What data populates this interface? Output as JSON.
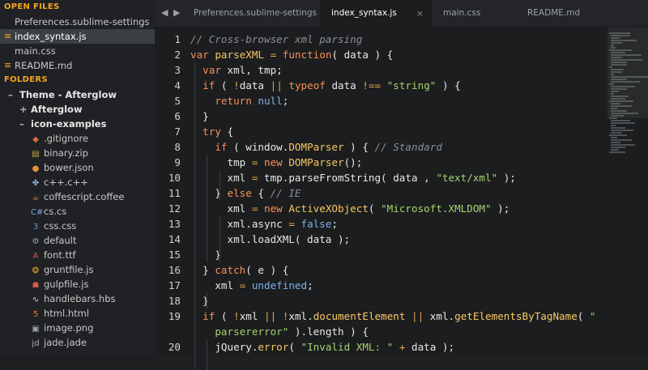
{
  "sidebar": {
    "open_files_header": "OPEN FILES",
    "open_files": [
      {
        "label": "Preferences.sublime-settings",
        "active": false,
        "modified": false
      },
      {
        "label": "index_syntax.js",
        "active": true,
        "modified": true
      },
      {
        "label": "main.css",
        "active": false,
        "modified": false
      },
      {
        "label": "README.md",
        "active": false,
        "modified": true
      }
    ],
    "folders_header": "FOLDERS",
    "tree": [
      {
        "label": "Theme - Afterglow",
        "depth": 0,
        "twist": "–",
        "bold": true
      },
      {
        "label": "Afterglow",
        "depth": 1,
        "twist": "+",
        "bold": true
      },
      {
        "label": "icon-examples",
        "depth": 1,
        "twist": "–",
        "bold": true
      },
      {
        "label": ".gitignore",
        "depth": 2,
        "icon": "◆",
        "icon_color": "#e0683a",
        "icon_name": "git-icon"
      },
      {
        "label": "binary.zip",
        "depth": 2,
        "icon": "▤",
        "icon_color": "#c7a34a",
        "icon_name": "zip-icon"
      },
      {
        "label": "bower.json",
        "depth": 2,
        "icon": "●",
        "icon_color": "#e8923a",
        "icon_name": "bower-icon"
      },
      {
        "label": "c++.c++",
        "depth": 2,
        "icon": "✤",
        "icon_color": "#8fb8d9",
        "icon_name": "cpp-icon"
      },
      {
        "label": "coffescript.coffee",
        "depth": 2,
        "icon": "☕",
        "icon_color": "#c98a4b",
        "icon_name": "coffee-icon"
      },
      {
        "label": "cs.cs",
        "depth": 2,
        "icon": "C#",
        "icon_color": "#7da9d6",
        "icon_name": "csharp-icon"
      },
      {
        "label": "css.css",
        "depth": 2,
        "icon": "3",
        "icon_color": "#5e9bd6",
        "icon_name": "css-icon"
      },
      {
        "label": "default",
        "depth": 2,
        "icon": "⚙",
        "icon_color": "#9aa6b2",
        "icon_name": "default-file-icon"
      },
      {
        "label": "font.ttf",
        "depth": 2,
        "icon": "A",
        "icon_color": "#d9534f",
        "icon_name": "font-icon"
      },
      {
        "label": "gruntfile.js",
        "depth": 2,
        "icon": "❂",
        "icon_color": "#e0a43a",
        "icon_name": "grunt-icon"
      },
      {
        "label": "gulpfile.js",
        "depth": 2,
        "icon": "☗",
        "icon_color": "#d9534f",
        "icon_name": "gulp-icon"
      },
      {
        "label": "handlebars.hbs",
        "depth": 2,
        "icon": "∿",
        "icon_color": "#d8d8d8",
        "icon_name": "handlebars-icon"
      },
      {
        "label": "html.html",
        "depth": 2,
        "icon": "5",
        "icon_color": "#e8793a",
        "icon_name": "html-icon"
      },
      {
        "label": "image.png",
        "depth": 2,
        "icon": "▣",
        "icon_color": "#9aa6b2",
        "icon_name": "image-icon"
      },
      {
        "label": "jade.jade",
        "depth": 2,
        "icon": "jd",
        "icon_color": "#b5b5b5",
        "icon_name": "jade-icon"
      }
    ]
  },
  "tabs": [
    {
      "label": "Preferences.sublime-settings",
      "active": false
    },
    {
      "label": "index_syntax.js",
      "active": true,
      "close": "×"
    },
    {
      "label": "main.css",
      "active": false
    },
    {
      "label": "README.md",
      "active": false
    }
  ],
  "nav": {
    "back": "◀",
    "forward": "▶"
  },
  "editor": {
    "lines": [
      {
        "n": "1",
        "tokens": [
          [
            "c-com",
            "// Cross-browser xml parsing"
          ]
        ]
      },
      {
        "n": "2",
        "tokens": [
          [
            "c-kw",
            "var "
          ],
          [
            "c-fn",
            "parseXML"
          ],
          [
            "c-op",
            " = "
          ],
          [
            "c-kw",
            "function"
          ],
          [
            "c-var",
            "( data ) {"
          ]
        ]
      },
      {
        "n": "3",
        "tokens": [
          [
            "c-var",
            "  "
          ],
          [
            "c-kw",
            "var "
          ],
          [
            "c-var",
            "xml, tmp;"
          ]
        ]
      },
      {
        "n": "4",
        "tokens": [
          [
            "c-var",
            "  "
          ],
          [
            "c-kw",
            "if "
          ],
          [
            "c-var",
            "( "
          ],
          [
            "c-op",
            "!"
          ],
          [
            "c-var",
            "data "
          ],
          [
            "c-op",
            "|| "
          ],
          [
            "c-kw",
            "typeof "
          ],
          [
            "c-var",
            "data "
          ],
          [
            "c-op",
            "!== "
          ],
          [
            "c-str",
            "\"string\""
          ],
          [
            "c-var",
            " ) {"
          ]
        ]
      },
      {
        "n": "5",
        "tokens": [
          [
            "c-var",
            "    "
          ],
          [
            "c-kw",
            "return "
          ],
          [
            "c-bool",
            "null"
          ],
          [
            "c-var",
            ";"
          ]
        ]
      },
      {
        "n": "6",
        "tokens": [
          [
            "c-var",
            "  }"
          ]
        ]
      },
      {
        "n": "7",
        "tokens": [
          [
            "c-var",
            "  "
          ],
          [
            "c-kw",
            "try "
          ],
          [
            "c-var",
            "{"
          ]
        ]
      },
      {
        "n": "8",
        "tokens": [
          [
            "c-var",
            "    "
          ],
          [
            "c-kw",
            "if "
          ],
          [
            "c-var",
            "( window."
          ],
          [
            "c-fn",
            "DOMParser"
          ],
          [
            "c-var",
            " ) { "
          ],
          [
            "c-com",
            "// Standard"
          ]
        ]
      },
      {
        "n": "9",
        "tokens": [
          [
            "c-var",
            "      tmp "
          ],
          [
            "c-op",
            "= "
          ],
          [
            "c-kw",
            "new "
          ],
          [
            "c-fn",
            "DOMParser"
          ],
          [
            "c-var",
            "();"
          ]
        ]
      },
      {
        "n": "10",
        "tokens": [
          [
            "c-var",
            "      xml "
          ],
          [
            "c-op",
            "= "
          ],
          [
            "c-var",
            "tmp.parseFromString( data , "
          ],
          [
            "c-str",
            "\"text/xml\""
          ],
          [
            "c-var",
            " );"
          ]
        ]
      },
      {
        "n": "11",
        "tokens": [
          [
            "c-var",
            "    } "
          ],
          [
            "c-kw",
            "else "
          ],
          [
            "c-var",
            "{ "
          ],
          [
            "c-com",
            "// IE"
          ]
        ]
      },
      {
        "n": "12",
        "tokens": [
          [
            "c-var",
            "      xml "
          ],
          [
            "c-op",
            "= "
          ],
          [
            "c-kw",
            "new "
          ],
          [
            "c-fn",
            "ActiveXObject"
          ],
          [
            "c-var",
            "( "
          ],
          [
            "c-str",
            "\"Microsoft.XMLDOM\""
          ],
          [
            "c-var",
            " );"
          ]
        ]
      },
      {
        "n": "13",
        "tokens": [
          [
            "c-var",
            "      xml.async "
          ],
          [
            "c-op",
            "= "
          ],
          [
            "c-bool",
            "false"
          ],
          [
            "c-var",
            ";"
          ]
        ]
      },
      {
        "n": "14",
        "tokens": [
          [
            "c-var",
            "      xml.loadXML( data );"
          ]
        ]
      },
      {
        "n": "15",
        "tokens": [
          [
            "c-var",
            "    }"
          ]
        ]
      },
      {
        "n": "16",
        "tokens": [
          [
            "c-var",
            "  } "
          ],
          [
            "c-kw",
            "catch"
          ],
          [
            "c-var",
            "( e ) {"
          ]
        ]
      },
      {
        "n": "17",
        "tokens": [
          [
            "c-var",
            "    xml "
          ],
          [
            "c-op",
            "= "
          ],
          [
            "c-bool",
            "undefined"
          ],
          [
            "c-var",
            ";"
          ]
        ]
      },
      {
        "n": "18",
        "tokens": [
          [
            "c-var",
            "  }"
          ]
        ]
      },
      {
        "n": "19",
        "tokens": [
          [
            "c-var",
            "  "
          ],
          [
            "c-kw",
            "if "
          ],
          [
            "c-var",
            "( "
          ],
          [
            "c-op",
            "!"
          ],
          [
            "c-var",
            "xml "
          ],
          [
            "c-op",
            "|| !"
          ],
          [
            "c-var",
            "xml."
          ],
          [
            "c-fn",
            "documentElement"
          ],
          [
            "c-op",
            " || "
          ],
          [
            "c-var",
            "xml."
          ],
          [
            "c-fn",
            "getElementsByTagName"
          ],
          [
            "c-var",
            "( "
          ],
          [
            "c-str",
            "\""
          ]
        ]
      },
      {
        "n": "",
        "tokens": [
          [
            "c-str",
            "    parsererror\""
          ],
          [
            "c-var",
            " ).length ) {"
          ]
        ]
      },
      {
        "n": "20",
        "tokens": [
          [
            "c-var",
            "    jQuery."
          ],
          [
            "c-fn",
            "error"
          ],
          [
            "c-var",
            "( "
          ],
          [
            "c-str",
            "\"Invalid XML: \""
          ],
          [
            "c-op",
            " + "
          ],
          [
            "c-var",
            "data );"
          ]
        ]
      }
    ]
  }
}
